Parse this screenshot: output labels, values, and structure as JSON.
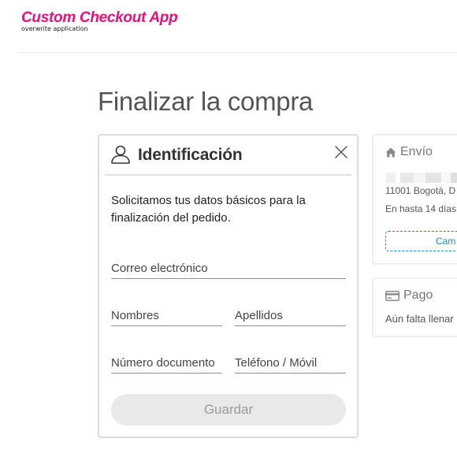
{
  "brand": {
    "title": "Custom Checkout App",
    "subtitle": "overwrite application",
    "color": "#e6117b"
  },
  "page": {
    "title": "Finalizar la compra"
  },
  "identification": {
    "title": "Identificación",
    "intro": "Solicitamos tus datos básicos para la finalización del pedido.",
    "fields": {
      "email": {
        "placeholder": "Correo electrónico",
        "value": ""
      },
      "first_name": {
        "placeholder": "Nombres",
        "value": ""
      },
      "last_name": {
        "placeholder": "Apellidos",
        "value": ""
      },
      "document": {
        "placeholder": "Número documento",
        "value": ""
      },
      "phone": {
        "placeholder": "Teléfono / Móvil",
        "value": ""
      }
    },
    "save_label": "Guardar"
  },
  "shipping": {
    "title": "Envío",
    "address": "11001 Bogotá, D",
    "eta": "En hasta 14 días",
    "change_label": "Cam"
  },
  "payment": {
    "title": "Pago",
    "status": "Aún falta llenar"
  },
  "colors": {
    "link": "#1f8ad0",
    "button_disabled_bg": "#e9e9e9",
    "button_disabled_text": "#9b9b9b"
  },
  "icons": [
    "user-icon",
    "close-icon",
    "home-icon",
    "credit-card-icon"
  ]
}
